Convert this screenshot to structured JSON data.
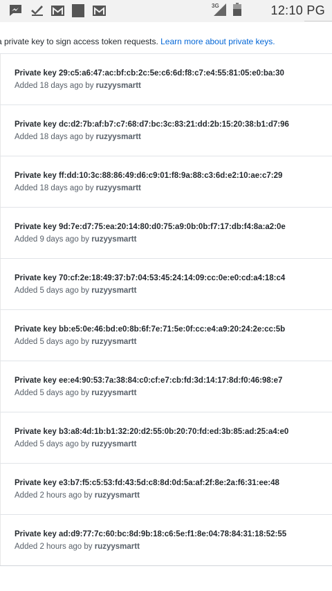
{
  "status_bar": {
    "time": "12:10 PG",
    "network": "3G",
    "icons": [
      "messenger-icon",
      "checkmark-icon",
      "gmail-icon",
      "square-app-icon",
      "gmail-icon",
      "signal-icon",
      "battery-icon"
    ]
  },
  "intro": {
    "text": "a private key to sign access token requests. ",
    "link": "Learn more about private keys."
  },
  "keys": [
    {
      "prefix": "Private key",
      "fingerprint": "29:c5:a6:47:ac:bf:cb:2c:5e:c6:6d:f8:c7:e4:55:81:05:e0:ba:30",
      "added": "Added 18 days ago by",
      "author": "ruzyysmartt"
    },
    {
      "prefix": "Private key",
      "fingerprint": "dc:d2:7b:af:b7:c7:68:d7:bc:3c:83:21:dd:2b:15:20:38:b1:d7:96",
      "added": "Added 18 days ago by",
      "author": "ruzyysmartt"
    },
    {
      "prefix": "Private key",
      "fingerprint": "ff:dd:10:3c:88:86:49:d6:c9:01:f8:9a:88:c3:6d:e2:10:ae:c7:29",
      "added": "Added 18 days ago by",
      "author": "ruzyysmartt"
    },
    {
      "prefix": "Private key",
      "fingerprint": "9d:7e:d7:75:ea:20:14:80:d0:75:a9:0b:0b:f7:17:db:f4:8a:a2:0e",
      "added": "Added 9 days ago by",
      "author": "ruzyysmartt"
    },
    {
      "prefix": "Private key",
      "fingerprint": "70:cf:2e:18:49:37:b7:04:53:45:24:14:09:cc:0e:e0:cd:a4:18:c4",
      "added": "Added 5 days ago by",
      "author": "ruzyysmartt"
    },
    {
      "prefix": "Private key",
      "fingerprint": "bb:e5:0e:46:bd:e0:8b:6f:7e:71:5e:0f:cc:e4:a9:20:24:2e:cc:5b",
      "added": "Added 5 days ago by",
      "author": "ruzyysmartt"
    },
    {
      "prefix": "Private key",
      "fingerprint": "ee:e4:90:53:7a:38:84:c0:cf:e7:cb:fd:3d:14:17:8d:f0:46:98:e7",
      "added": "Added 5 days ago by",
      "author": "ruzyysmartt"
    },
    {
      "prefix": "Private key",
      "fingerprint": "b3:a8:4d:1b:b1:32:20:d2:55:0b:20:70:fd:ed:3b:85:ad:25:a4:e0",
      "added": "Added 5 days ago by",
      "author": "ruzyysmartt"
    },
    {
      "prefix": "Private key",
      "fingerprint": "e3:b7:f5:c5:53:fd:43:5d:c8:8d:0d:5a:af:2f:8e:2a:f6:31:ee:48",
      "added": "Added 2 hours ago by",
      "author": "ruzyysmartt"
    },
    {
      "prefix": "Private key",
      "fingerprint": "ad:d9:77:7c:60:bc:8d:9b:18:c6:5e:f1:8e:04:78:84:31:18:52:55",
      "added": "Added 2 hours ago by",
      "author": "ruzyysmartt"
    }
  ]
}
